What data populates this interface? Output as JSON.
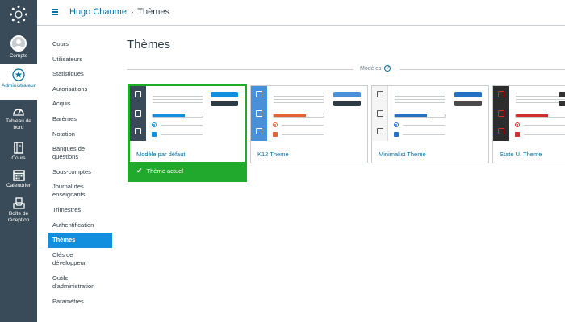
{
  "global_nav": {
    "items": [
      {
        "label": "Compte"
      },
      {
        "label": "Administrateur"
      },
      {
        "label": "Tableau de bord"
      },
      {
        "label": "Cours"
      },
      {
        "label": "Calendrier"
      },
      {
        "label": "Boîte de réception"
      }
    ]
  },
  "header": {
    "breadcrumb_link": "Hugo Chaume",
    "breadcrumb_separator": "›",
    "breadcrumb_current": "Thèmes"
  },
  "subnav": {
    "items": [
      {
        "label": "Cours"
      },
      {
        "label": "Utilisateurs"
      },
      {
        "label": "Statistiques"
      },
      {
        "label": "Autorisations"
      },
      {
        "label": "Acquis"
      },
      {
        "label": "Barèmes"
      },
      {
        "label": "Notation"
      },
      {
        "label": "Banques de questions"
      },
      {
        "label": "Sous-comptes"
      },
      {
        "label": "Journal des enseignants"
      },
      {
        "label": "Trimestres"
      },
      {
        "label": "Authentification"
      },
      {
        "label": "Thèmes"
      },
      {
        "label": "Clés de développeur"
      },
      {
        "label": "Outils d'administration"
      },
      {
        "label": "Paramètres"
      }
    ]
  },
  "main": {
    "title": "Thèmes",
    "section_label": "Modèles",
    "help_glyph": "?",
    "current_theme_label": "Thème actuel",
    "themes": [
      {
        "name": "Modèle par défaut",
        "strip": "#394b58",
        "primary": "#0f8fde",
        "secondary": "#2d3b45",
        "accent": "#0f8fde"
      },
      {
        "name": "K12 Theme",
        "strip": "#4a90d9",
        "primary": "#4a90d9",
        "secondary": "#2d3b45",
        "accent": "#e66135"
      },
      {
        "name": "Minimalist Theme",
        "strip": "#f5f5f5",
        "primary": "#2572c4",
        "secondary": "#4a4a4a",
        "accent": "#2572c4"
      },
      {
        "name": "State U. Theme",
        "strip": "#2d2d2d",
        "primary": "#333333",
        "secondary": "#333333",
        "accent": "#d12e2e"
      }
    ]
  },
  "colors": {
    "nav_bg": "#394b58",
    "link": "#0770a3",
    "active_subnav": "#0f8fde",
    "selected_green": "#20a92c"
  }
}
